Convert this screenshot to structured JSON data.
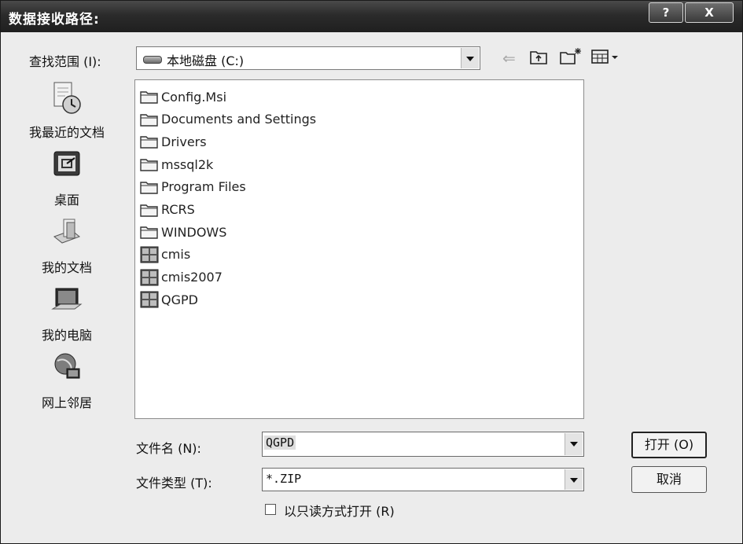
{
  "dialog": {
    "title": "数据接收路径:",
    "help_glyph": "?",
    "close_glyph": "X"
  },
  "lookin": {
    "label": "查找范围 (I):",
    "value": "本地磁盘 (C:)"
  },
  "places": [
    {
      "label": "我最近的文档",
      "icon": "recent-documents-icon"
    },
    {
      "label": "桌面",
      "icon": "desktop-icon"
    },
    {
      "label": "我的文档",
      "icon": "my-documents-icon"
    },
    {
      "label": "我的电脑",
      "icon": "my-computer-icon"
    },
    {
      "label": "网上邻居",
      "icon": "network-places-icon"
    }
  ],
  "files": [
    {
      "name": "Config.Msi",
      "kind": "folder"
    },
    {
      "name": "Documents and Settings",
      "kind": "folder"
    },
    {
      "name": "Drivers",
      "kind": "folder"
    },
    {
      "name": "mssql2k",
      "kind": "folder"
    },
    {
      "name": "Program Files",
      "kind": "folder"
    },
    {
      "name": "RCRS",
      "kind": "folder"
    },
    {
      "name": "WINDOWS",
      "kind": "folder"
    },
    {
      "name": "cmis",
      "kind": "app"
    },
    {
      "name": "cmis2007",
      "kind": "app"
    },
    {
      "name": "QGPD",
      "kind": "app"
    }
  ],
  "filename": {
    "label": "文件名 (N):",
    "value": "QGPD"
  },
  "filetype": {
    "label": "文件类型 (T):",
    "value": "*.ZIP"
  },
  "readonly": {
    "label": "以只读方式打开 (R)"
  },
  "buttons": {
    "open": "打开 (O)",
    "cancel": "取消"
  },
  "toolbar": {
    "back_glyph": "⇐",
    "up_glyph": "⮤",
    "newfolder_glyph": "✳",
    "views_glyph": "▤▾"
  }
}
